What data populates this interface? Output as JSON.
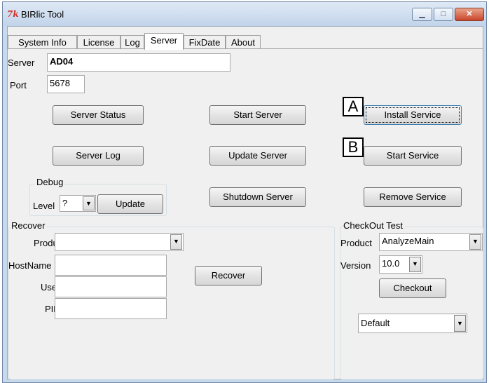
{
  "window": {
    "title": "BIRlic Tool",
    "icon_text": "7k",
    "controls": {
      "minimize": "▁",
      "maximize": "□",
      "close": "✕"
    }
  },
  "tabs": [
    "System Info",
    "License",
    "Log",
    "Server",
    "FixDate",
    "About"
  ],
  "active_tab": "Server",
  "server": {
    "label": "Server",
    "value": "AD04"
  },
  "port": {
    "label": "Port",
    "value": "5678"
  },
  "buttons": {
    "server_status": "Server Status",
    "start_server": "Start Server",
    "install_service": "Install Service",
    "server_log": "Server Log",
    "update_server": "Update Server",
    "start_service": "Start Service",
    "shutdown_server": "Shutdown Server",
    "remove_service": "Remove Service",
    "update": "Update",
    "recover": "Recover",
    "checkout": "Checkout"
  },
  "debug": {
    "group_label": "Debug",
    "level_label": "Level",
    "level_value": "?"
  },
  "recover": {
    "group_label": "Recover",
    "product_label": "Product",
    "product_value": "",
    "hostname_label": "HostName",
    "user_label": "User",
    "pid_label": "PID"
  },
  "checkout": {
    "group_label": "CheckOut Test",
    "product_label": "Product",
    "product_value": "AnalyzeMain",
    "version_label": "Version",
    "version_value": "10.0",
    "profile_value": "Default"
  },
  "markers": {
    "a": "A",
    "b": "B"
  },
  "colors": {
    "title_bg": "#c9d9ec",
    "close_red": "#c9452a",
    "client_bg": "#f0f0f0"
  }
}
